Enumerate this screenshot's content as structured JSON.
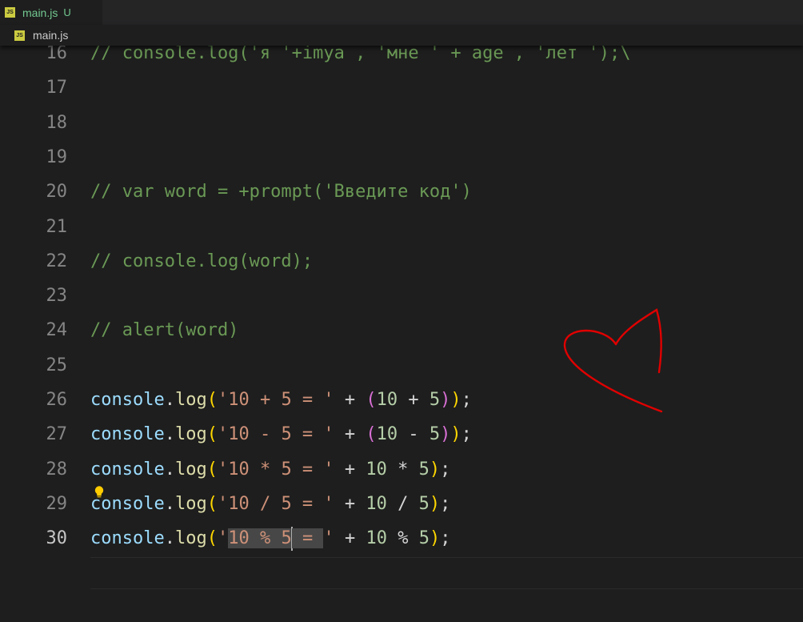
{
  "tabs": [
    {
      "label": "main.js",
      "status": "U",
      "icon": "js-file-icon"
    }
  ],
  "breadcrumb": {
    "file": "main.js",
    "icon": "js-file-icon"
  },
  "editor": {
    "active_line": "30",
    "lines": [
      {
        "n": "16",
        "tokens": [
          {
            "t": "// console.log('я '+imya , 'мне ' + age , 'лет ');\\",
            "c": "c-com"
          }
        ]
      },
      {
        "n": "17",
        "tokens": []
      },
      {
        "n": "18",
        "tokens": []
      },
      {
        "n": "19",
        "tokens": []
      },
      {
        "n": "20",
        "tokens": [
          {
            "t": "// var word = +prompt('Введите код')",
            "c": "c-com"
          }
        ]
      },
      {
        "n": "21",
        "tokens": []
      },
      {
        "n": "22",
        "tokens": [
          {
            "t": "// console.log(word);",
            "c": "c-com"
          }
        ]
      },
      {
        "n": "23",
        "tokens": []
      },
      {
        "n": "24",
        "tokens": [
          {
            "t": "// alert(word)",
            "c": "c-com"
          }
        ]
      },
      {
        "n": "25",
        "tokens": []
      },
      {
        "n": "26",
        "tokens": [
          {
            "t": "console",
            "c": "c-obj"
          },
          {
            "t": ".",
            "c": "c-op"
          },
          {
            "t": "log",
            "c": "c-fn"
          },
          {
            "t": "(",
            "c": "b1"
          },
          {
            "t": "'10 + 5 = '",
            "c": "c-str"
          },
          {
            "t": " + ",
            "c": "c-op"
          },
          {
            "t": "(",
            "c": "b2"
          },
          {
            "t": "10",
            "c": "c-num"
          },
          {
            "t": " + ",
            "c": "c-op"
          },
          {
            "t": "5",
            "c": "c-num"
          },
          {
            "t": ")",
            "c": "b2"
          },
          {
            "t": ")",
            "c": "b1"
          },
          {
            "t": ";",
            "c": "c-op"
          }
        ]
      },
      {
        "n": "27",
        "tokens": [
          {
            "t": "console",
            "c": "c-obj"
          },
          {
            "t": ".",
            "c": "c-op"
          },
          {
            "t": "log",
            "c": "c-fn"
          },
          {
            "t": "(",
            "c": "b1"
          },
          {
            "t": "'10 - 5 = '",
            "c": "c-str"
          },
          {
            "t": " + ",
            "c": "c-op"
          },
          {
            "t": "(",
            "c": "b2"
          },
          {
            "t": "10",
            "c": "c-num"
          },
          {
            "t": " - ",
            "c": "c-op"
          },
          {
            "t": "5",
            "c": "c-num"
          },
          {
            "t": ")",
            "c": "b2"
          },
          {
            "t": ")",
            "c": "b1"
          },
          {
            "t": ";",
            "c": "c-op"
          }
        ]
      },
      {
        "n": "28",
        "tokens": [
          {
            "t": "console",
            "c": "c-obj"
          },
          {
            "t": ".",
            "c": "c-op"
          },
          {
            "t": "log",
            "c": "c-fn"
          },
          {
            "t": "(",
            "c": "b1"
          },
          {
            "t": "'10 * 5 = '",
            "c": "c-str"
          },
          {
            "t": " + ",
            "c": "c-op"
          },
          {
            "t": "10",
            "c": "c-num"
          },
          {
            "t": " * ",
            "c": "c-op"
          },
          {
            "t": "5",
            "c": "c-num"
          },
          {
            "t": ")",
            "c": "b1"
          },
          {
            "t": ";",
            "c": "c-op"
          }
        ]
      },
      {
        "n": "29",
        "tokens": [
          {
            "t": "console",
            "c": "c-obj"
          },
          {
            "t": ".",
            "c": "c-op"
          },
          {
            "t": "log",
            "c": "c-fn"
          },
          {
            "t": "(",
            "c": "b1"
          },
          {
            "t": "'10 / 5 = '",
            "c": "c-str"
          },
          {
            "t": " + ",
            "c": "c-op"
          },
          {
            "t": "10",
            "c": "c-num"
          },
          {
            "t": " / ",
            "c": "c-op"
          },
          {
            "t": "5",
            "c": "c-num"
          },
          {
            "t": ")",
            "c": "b1"
          },
          {
            "t": ";",
            "c": "c-op"
          }
        ]
      },
      {
        "n": "30",
        "tokens": [
          {
            "t": "console",
            "c": "c-obj"
          },
          {
            "t": ".",
            "c": "c-op"
          },
          {
            "t": "log",
            "c": "c-fn"
          },
          {
            "t": "(",
            "c": "b1"
          },
          {
            "t": "'",
            "c": "c-str"
          },
          {
            "t": "10 % 5",
            "c": "c-str sel"
          },
          {
            "cursor": true
          },
          {
            "t": " = ",
            "c": "c-str sel"
          },
          {
            "t": "'",
            "c": "c-str"
          },
          {
            "t": " + ",
            "c": "c-op"
          },
          {
            "t": "10",
            "c": "c-num"
          },
          {
            "t": " % ",
            "c": "c-op"
          },
          {
            "t": "5",
            "c": "c-num"
          },
          {
            "t": ")",
            "c": "b1"
          },
          {
            "t": ";",
            "c": "c-op"
          }
        ]
      }
    ]
  },
  "annotation": {
    "shape": "heart-drawing",
    "color": "#e00000"
  },
  "lightbulb": {
    "icon": "lightbulb-icon",
    "color": "#ffcc00"
  }
}
